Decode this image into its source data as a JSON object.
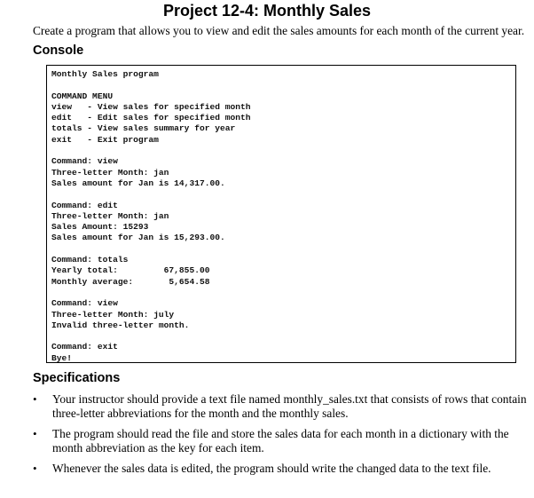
{
  "document": {
    "title": "Project 12-4: Monthly Sales",
    "intro": "Create a program that allows you to view and edit the sales amounts for each month of the current year."
  },
  "console": {
    "heading": "Console",
    "lines": [
      "Monthly Sales program",
      "",
      "COMMAND MENU",
      "view   - View sales for specified month",
      "edit   - Edit sales for specified month",
      "totals - View sales summary for year",
      "exit   - Exit program",
      "",
      "Command: view",
      "Three-letter Month: jan",
      "Sales amount for Jan is 14,317.00.",
      "",
      "Command: edit",
      "Three-letter Month: jan",
      "Sales Amount: 15293",
      "Sales amount for Jan is 15,293.00.",
      "",
      "Command: totals",
      "Yearly total:         67,855.00",
      "Monthly average:       5,654.58",
      "",
      "Command: view",
      "Three-letter Month: july",
      "Invalid three-letter month.",
      "",
      "Command: exit",
      "Bye!"
    ]
  },
  "specifications": {
    "heading": "Specifications",
    "bullet_icon": "•",
    "items": [
      "Your instructor should provide a text file named monthly_sales.txt that consists of rows that contain three-letter abbreviations for the month and the monthly sales.",
      "The program should read the file and store the sales data for each month in a dictionary with the month abbreviation as the key for each item.",
      "Whenever the sales data is edited, the program should write the changed data to the text file."
    ]
  }
}
